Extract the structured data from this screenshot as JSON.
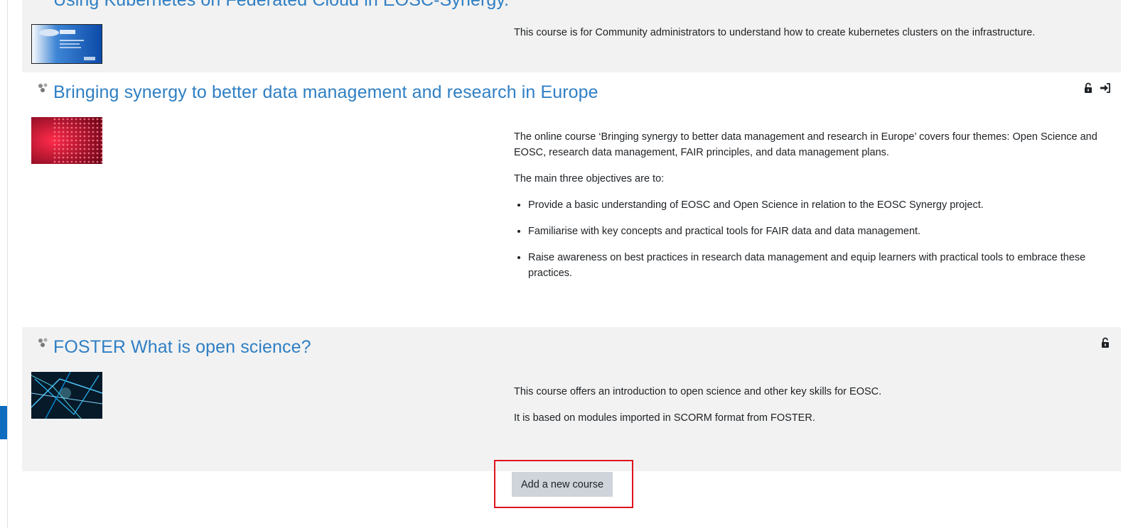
{
  "courses": [
    {
      "title": "Using Kubernetes on Federated Cloud in EOSC-Synergy.",
      "summary": [
        "This course is for Community administrators to understand how to create kubernetes clusters on the infrastructure."
      ],
      "actions": []
    },
    {
      "title": "Bringing synergy to better data management and research in Europe",
      "summary": [
        "The online course ‘Bringing synergy to better data management and research in Europe’ covers four themes: Open Science and EOSC, research data management, FAIR principles, and data management plans.",
        "The main three objectives are to:"
      ],
      "objectives": [
        "Provide a basic understanding of EOSC and Open Science in relation to the EOSC Synergy project.",
        "Familiarise with key concepts and practical tools for FAIR data and data management.",
        "Raise awareness on best practices in research data management and equip learners with practical tools to embrace these practices."
      ],
      "actions": [
        "unlock-icon",
        "sign-in-icon"
      ]
    },
    {
      "title": "FOSTER What is open science?",
      "summary": [
        "This course offers an introduction to open science and other key skills for EOSC.",
        "It is based on modules imported in SCORM format from FOSTER."
      ],
      "actions": [
        "unlock-icon"
      ]
    }
  ],
  "add_course_label": "Add a new course",
  "colors": {
    "link": "#2f7fc4",
    "stripe": "#f2f2f2",
    "button": "#ced4da",
    "highlight": "#e0141e",
    "accent": "#0f6cbf"
  }
}
